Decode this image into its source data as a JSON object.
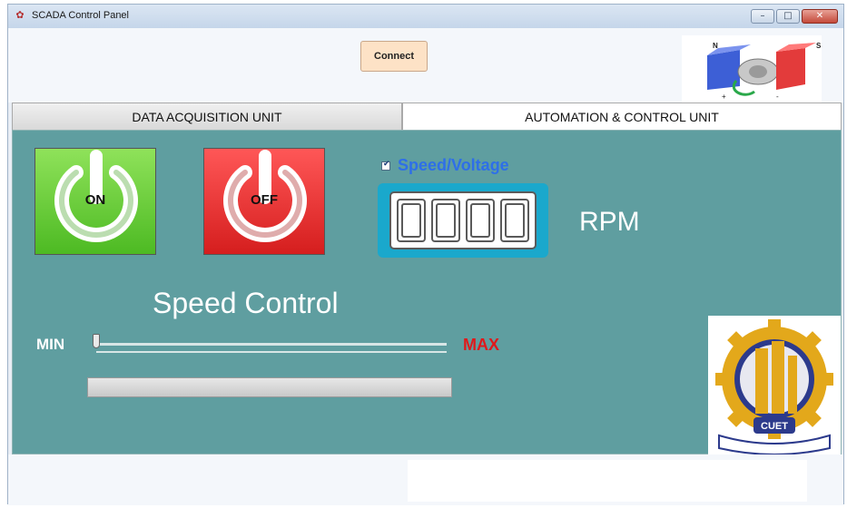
{
  "window": {
    "title": "SCADA Control Panel",
    "icon": "app-icon"
  },
  "window_controls": {
    "minimize": "–",
    "maximize": "□",
    "close": "✕"
  },
  "toolbar": {
    "connect_label": "Connect"
  },
  "tabs": [
    {
      "label": "DATA ACQUISITION UNIT",
      "active": false
    },
    {
      "label": "AUTOMATION & CONTROL UNIT",
      "active": true
    }
  ],
  "controls": {
    "on_label": "ON",
    "off_label": "OFF",
    "checkbox": {
      "label": "Speed/Voltage",
      "checked": true
    },
    "display": {
      "value": "0000",
      "unit": "RPM"
    },
    "speed_title": "Speed Control",
    "slider": {
      "min_label": "MIN",
      "max_label": "MAX",
      "value_fraction": 0
    },
    "progress": {
      "value_fraction": 0
    }
  },
  "colors": {
    "panel_bg": "#5f9ea0",
    "on_button": "#4dba23",
    "off_button": "#d51e1e",
    "display_bg": "#1aa8cc",
    "checkbox_label": "#2e6fe8",
    "max_label": "#e0191b"
  },
  "logo": {
    "text": "CUET"
  }
}
